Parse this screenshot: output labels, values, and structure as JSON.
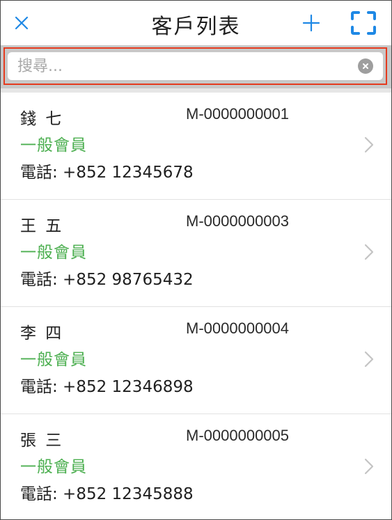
{
  "header": {
    "title": "客戶列表"
  },
  "search": {
    "placeholder": "搜尋..."
  },
  "colors": {
    "accent_blue": "#1e88e5",
    "member_green": "#4caf50",
    "highlight_red": "#e53a1e"
  },
  "icons": {
    "close": "close-icon",
    "add": "plus-icon",
    "scan": "scan-icon",
    "clear": "clear-icon",
    "row_arrow": "chevron-right-icon"
  },
  "customers": [
    {
      "name": "錢 七",
      "id": "M-0000000001",
      "level": "一般會員",
      "phone": "電話: +852 12345678"
    },
    {
      "name": "王 五",
      "id": "M-0000000003",
      "level": "一般會員",
      "phone": "電話: +852 98765432"
    },
    {
      "name": "李 四",
      "id": "M-0000000004",
      "level": "一般會員",
      "phone": "電話: +852 12346898"
    },
    {
      "name": "張 三",
      "id": "M-0000000005",
      "level": "一般會員",
      "phone": "電話: +852 12345888"
    }
  ]
}
